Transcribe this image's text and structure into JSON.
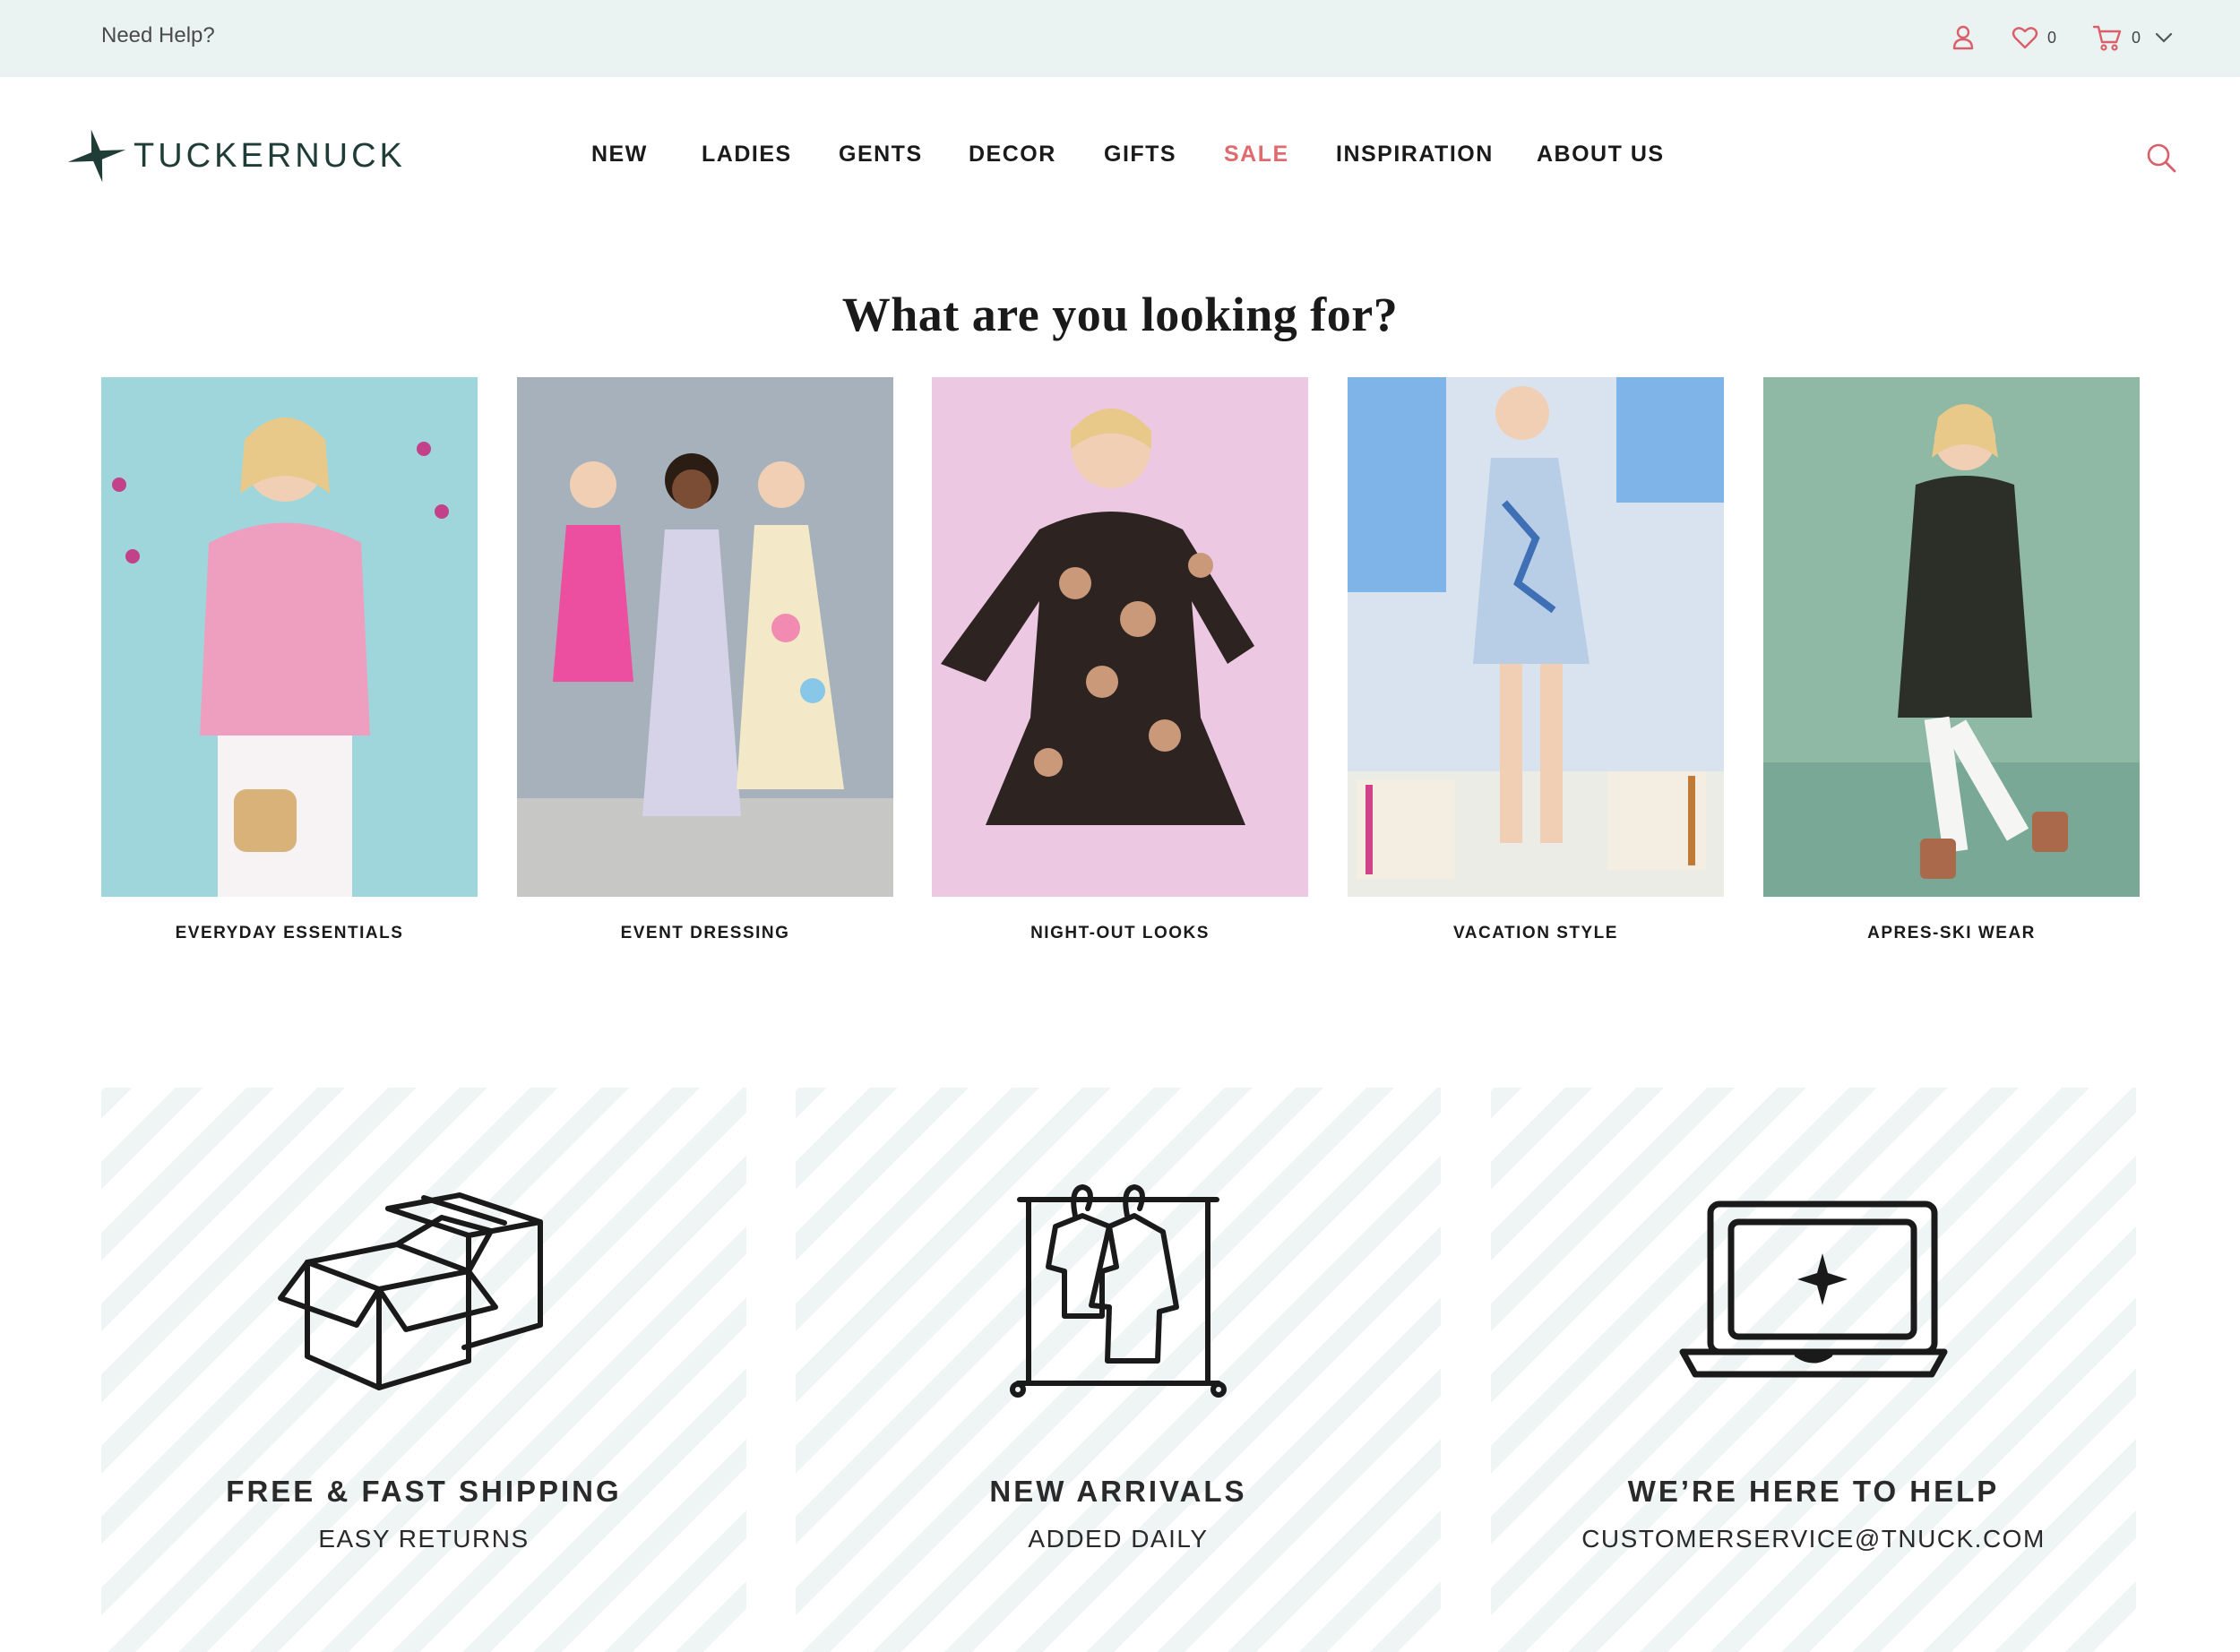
{
  "topbar": {
    "help_label": "Need Help?",
    "wishlist_count": "0",
    "cart_count": "0",
    "icons": [
      "user-icon",
      "heart-icon",
      "cart-icon",
      "chevron-down-icon"
    ]
  },
  "brand": {
    "name": "TUCKERNUCK",
    "logo_color": "#1f3d36"
  },
  "nav": {
    "items": [
      {
        "label": "NEW"
      },
      {
        "label": "LADIES"
      },
      {
        "label": "GENTS"
      },
      {
        "label": "DECOR"
      },
      {
        "label": "GIFTS"
      },
      {
        "label": "SALE"
      },
      {
        "label": "INSPIRATION"
      },
      {
        "label": "ABOUT US"
      }
    ],
    "sale_color": "#e06b6f",
    "search_icon": "search-icon"
  },
  "categories": {
    "title": "What are you looking for?",
    "items": [
      {
        "label": "EVERYDAY ESSENTIALS",
        "bg": "#9fd6db"
      },
      {
        "label": "EVENT DRESSING",
        "bg": "#a6b1bb"
      },
      {
        "label": "NIGHT-OUT LOOKS",
        "bg": "#ecc8e2"
      },
      {
        "label": "VACATION STYLE",
        "bg": "#d9e3ef"
      },
      {
        "label": "APRES-SKI WEAR",
        "bg": "#8fb9a5"
      }
    ]
  },
  "value_props": [
    {
      "title": "FREE & FAST SHIPPING",
      "subtitle": "EASY RETURNS",
      "icon": "boxes-icon"
    },
    {
      "title": "NEW ARRIVALS",
      "subtitle": "ADDED DAILY",
      "icon": "clothing-rack-icon"
    },
    {
      "title": "WE’RE HERE TO HELP",
      "subtitle": "CUSTOMERSERVICE@TNUCK.COM",
      "icon": "laptop-icon"
    }
  ]
}
